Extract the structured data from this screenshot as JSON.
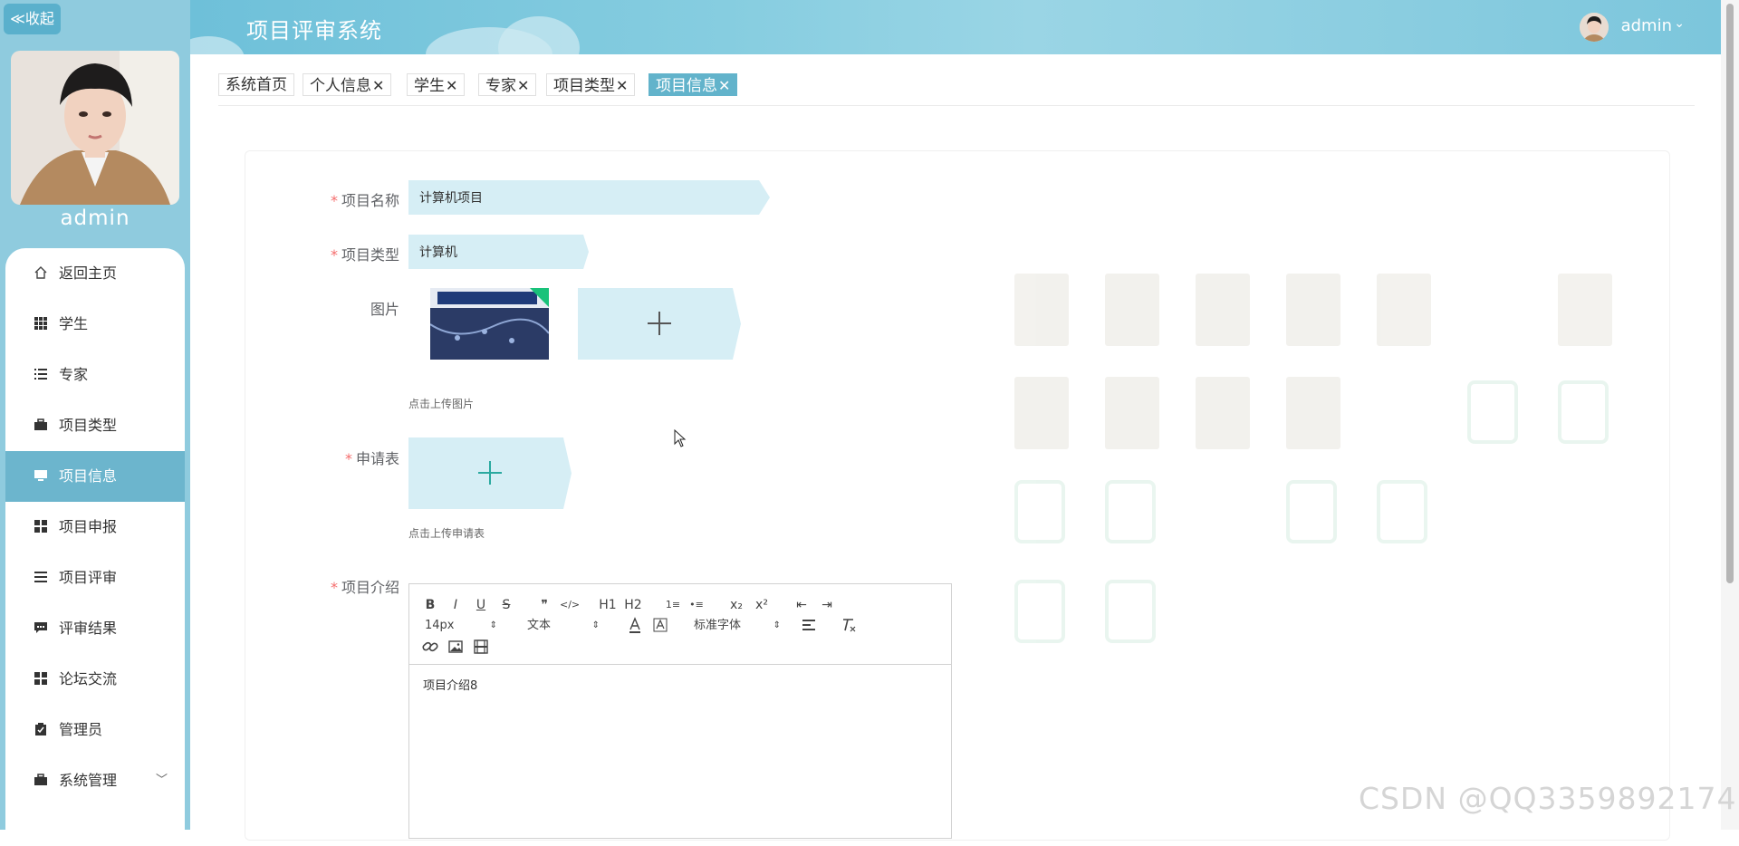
{
  "sidebar": {
    "collapse_label": "≪收起",
    "username": "admin",
    "items": [
      {
        "label": "返回主页",
        "icon": "home-icon"
      },
      {
        "label": "学生",
        "icon": "grid-icon"
      },
      {
        "label": "专家",
        "icon": "list-icon"
      },
      {
        "label": "项目类型",
        "icon": "briefcase-icon"
      },
      {
        "label": "项目信息",
        "icon": "monitor-icon",
        "active": true
      },
      {
        "label": "项目申报",
        "icon": "apps-icon"
      },
      {
        "label": "项目评审",
        "icon": "list-icon"
      },
      {
        "label": "评审结果",
        "icon": "comment-icon"
      },
      {
        "label": "论坛交流",
        "icon": "apps-icon"
      },
      {
        "label": "管理员",
        "icon": "clipboard-icon"
      },
      {
        "label": "系统管理",
        "icon": "briefcase-icon",
        "caret": "﹀"
      }
    ]
  },
  "header": {
    "title": "项目评审系统",
    "user": "admin",
    "caret": "⌄"
  },
  "tabs": [
    {
      "label": "系统首页",
      "closable": false
    },
    {
      "label": "个人信息",
      "closable": true
    },
    {
      "label": "学生",
      "closable": true
    },
    {
      "label": "专家",
      "closable": true
    },
    {
      "label": "项目类型",
      "closable": true
    },
    {
      "label": "项目信息",
      "closable": true,
      "active": true
    }
  ],
  "form": {
    "name": {
      "label": "项目名称",
      "value": "计算机项目"
    },
    "type": {
      "label": "项目类型",
      "value": "计算机"
    },
    "image": {
      "label": "图片",
      "hint": "点击上传图片"
    },
    "application": {
      "label": "申请表",
      "hint": "点击上传申请表"
    },
    "intro": {
      "label": "项目介绍",
      "content": "项目介绍8"
    }
  },
  "editor": {
    "toolbar_row1": [
      "B",
      "I",
      "U",
      "S",
      "❞",
      "</>",
      "H1",
      "H2",
      "1≡",
      "•≡",
      "x₂",
      "x²",
      "⇤",
      "⇥"
    ],
    "font_size": "14px",
    "text_style": "文本",
    "font_family": "标准字体",
    "select_arrow": "⇕"
  },
  "colors": {
    "sidebar": "#8fcbde",
    "accent": "#62b3cb",
    "input_bg": "#d6eef5",
    "required": "#f56c6c"
  },
  "watermark": "CSDN @QQ3359892174"
}
